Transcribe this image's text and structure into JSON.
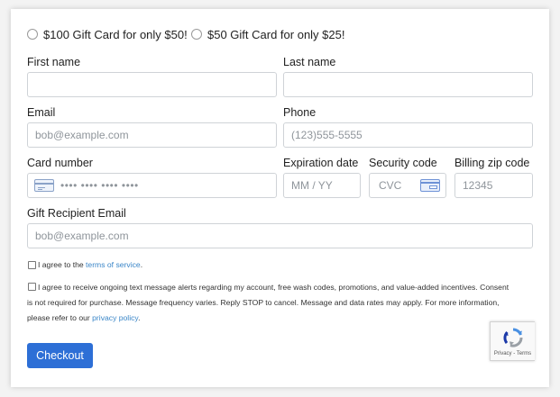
{
  "options": [
    {
      "label": "$100 Gift Card for only $50!"
    },
    {
      "label": "$50 Gift Card for only $25!"
    }
  ],
  "fields": {
    "first_name": {
      "label": "First name",
      "value": "",
      "placeholder": ""
    },
    "last_name": {
      "label": "Last name",
      "value": "",
      "placeholder": ""
    },
    "email": {
      "label": "Email",
      "placeholder": "bob@example.com"
    },
    "phone": {
      "label": "Phone",
      "placeholder": "(123)555-5555"
    },
    "card_number": {
      "label": "Card number",
      "placeholder": "•••• •••• •••• ••••"
    },
    "expiration": {
      "label": "Expiration date",
      "placeholder": "MM / YY"
    },
    "security_code": {
      "label": "Security code",
      "placeholder": "CVC"
    },
    "zip": {
      "label": "Billing zip code",
      "placeholder": "12345"
    },
    "recipient_email": {
      "label": "Gift Recipient Email",
      "placeholder": "bob@example.com"
    }
  },
  "terms": {
    "prefix": "I agree to the ",
    "link": "terms of service",
    "suffix": "."
  },
  "sms": {
    "line1": "I agree to receive ongoing text message alerts regarding my account, free wash codes, promotions, and value-added incentives. Consent",
    "line2": "is not required for purchase. Message frequency varies. Reply STOP to cancel. Message and data rates may apply. For more information,",
    "line3_prefix": "please refer to our ",
    "line3_link": "privacy policy",
    "line3_suffix": "."
  },
  "checkout": {
    "label": "Checkout"
  },
  "recaptcha": {
    "footer": "Privacy - Terms"
  },
  "colors": {
    "accent": "#2d6fd6",
    "link": "#3a86c8",
    "border": "#cfd3d7"
  },
  "icons": {
    "card": "credit-card-icon",
    "cvc": "cvc-card-icon",
    "recaptcha": "recaptcha-logo-icon"
  }
}
